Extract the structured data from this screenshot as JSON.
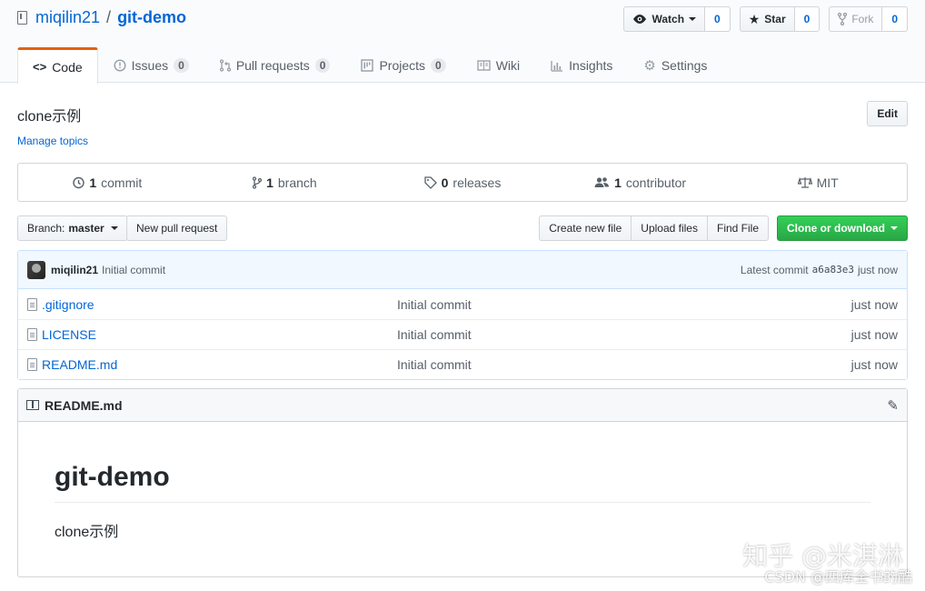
{
  "repo": {
    "owner": "miqilin21",
    "separator": "/",
    "name": "git-demo"
  },
  "actions": {
    "watch": {
      "label": "Watch",
      "count": "0"
    },
    "star": {
      "label": "Star",
      "count": "0"
    },
    "fork": {
      "label": "Fork",
      "count": "0"
    }
  },
  "nav": {
    "code": "Code",
    "issues": "Issues",
    "issues_count": "0",
    "pulls": "Pull requests",
    "pulls_count": "0",
    "projects": "Projects",
    "projects_count": "0",
    "wiki": "Wiki",
    "insights": "Insights",
    "settings": "Settings"
  },
  "description": "clone示例",
  "manage_topics": "Manage topics",
  "edit_label": "Edit",
  "summary": {
    "commits_num": "1",
    "commits_label": "commit",
    "branches_num": "1",
    "branches_label": "branch",
    "releases_num": "0",
    "releases_label": "releases",
    "contributors_num": "1",
    "contributors_label": "contributor",
    "license": "MIT"
  },
  "filenav": {
    "branch_prefix": "Branch:",
    "branch_name": "master",
    "new_pr": "New pull request",
    "create_file": "Create new file",
    "upload_files": "Upload files",
    "find_file": "Find File",
    "clone": "Clone or download"
  },
  "latest_commit": {
    "author": "miqilin21",
    "message": "Initial commit",
    "prefix": "Latest commit",
    "sha": "a6a83e3",
    "age": "just now"
  },
  "files": [
    {
      "name": ".gitignore",
      "commit": "Initial commit",
      "age": "just now"
    },
    {
      "name": "LICENSE",
      "commit": "Initial commit",
      "age": "just now"
    },
    {
      "name": "README.md",
      "commit": "Initial commit",
      "age": "just now"
    }
  ],
  "readme": {
    "filename": "README.md",
    "heading": "git-demo",
    "body": "clone示例"
  },
  "watermark": {
    "line1": "知乎 @米淇淋",
    "line2": "CSDN @四库全书的酷"
  },
  "colors": {
    "accent_tab": "#e36209",
    "link": "#0366d6",
    "green": "#28a745"
  }
}
